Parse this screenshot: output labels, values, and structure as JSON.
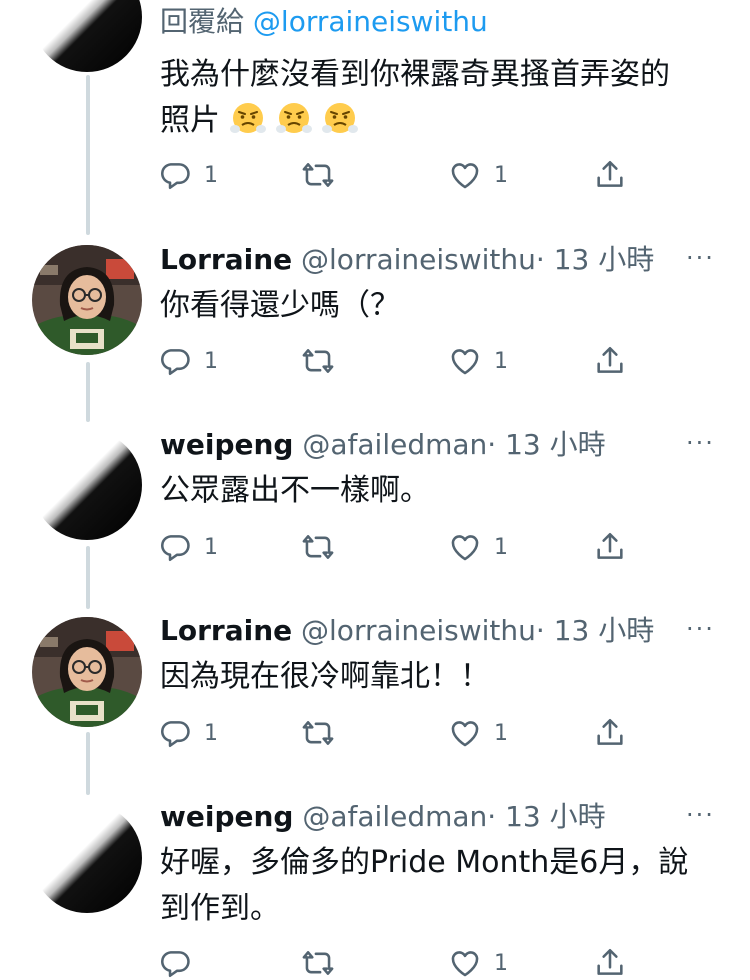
{
  "reply_context": {
    "prefix": "回覆給",
    "handle": "@lorraineiswithu"
  },
  "tweets": [
    {
      "avatar": "black-white-diagonal",
      "text_lines": [
        "我為什麼沒看到你裸露奇異搔首弄姿的",
        "照片"
      ],
      "emojis": [
        "face-with-steam-from-nose",
        "face-with-steam-from-nose",
        "face-with-steam-from-nose"
      ],
      "reply_count": "1",
      "like_count": "1"
    },
    {
      "avatar": "girl-with-glasses-photo",
      "name": "Lorraine",
      "handle": "@lorraineiswithu",
      "time": "· 13 小時",
      "text": "你看得還少嗎（？",
      "reply_count": "1",
      "like_count": "1"
    },
    {
      "avatar": "black-white-diagonal",
      "name": "weipeng",
      "handle": "@afailedman",
      "time": "· 13 小時",
      "text": "公眾露出不一樣啊。",
      "reply_count": "1",
      "like_count": "1"
    },
    {
      "avatar": "girl-with-glasses-photo",
      "name": "Lorraine",
      "handle": "@lorraineiswithu",
      "time": "· 13 小時",
      "text": "因為現在很冷啊靠北！！",
      "reply_count": "1",
      "like_count": "1"
    },
    {
      "avatar": "black-white-diagonal",
      "name": "weipeng",
      "handle": "@afailedman",
      "time": "· 13 小時",
      "text_lines": [
        "好喔，多倫多的Pride Month是6月，說",
        "到作到。"
      ],
      "like_count": "1"
    }
  ],
  "more_label": "···",
  "icons": {
    "reply": "reply-icon",
    "retweet": "retweet-icon",
    "like": "heart-icon",
    "share": "share-icon",
    "more": "more-icon"
  },
  "colors": {
    "accent": "#1d9bf0",
    "muted": "#536471",
    "text": "#0f1419",
    "thread_line": "#cfd9de"
  }
}
